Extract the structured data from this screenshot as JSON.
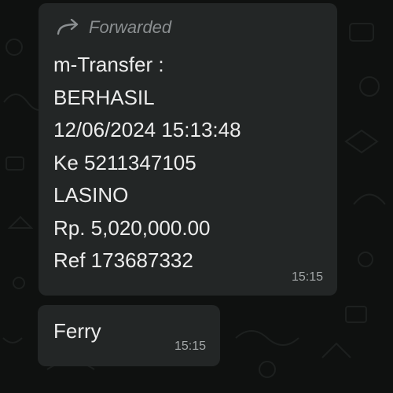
{
  "chat": {
    "messages": [
      {
        "forwarded_label": "Forwarded",
        "lines": [
          "m-Transfer :",
          "BERHASIL",
          "12/06/2024 15:13:48",
          "Ke 5211347105",
          "LASINO",
          "Rp. 5,020,000.00",
          "Ref 173687332"
        ],
        "time": "15:15",
        "icon": "forward-arrow-icon"
      },
      {
        "text": "Ferry",
        "time": "15:15"
      }
    ]
  },
  "colors": {
    "background": "#0f1110",
    "bubble": "#232626",
    "text": "#ececec",
    "meta_text": "#8b8f91"
  }
}
